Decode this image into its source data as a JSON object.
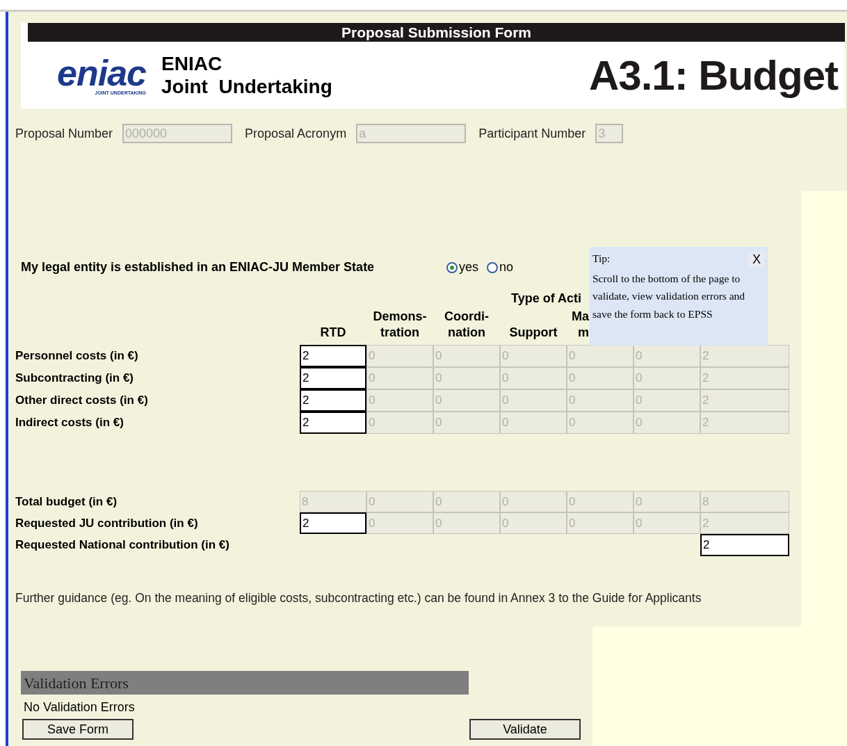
{
  "header": {
    "bar_title": "Proposal Submission Form",
    "logo_text": "eniac",
    "logo_subtitle": "JOINT UNDERTAKING",
    "org_line1": "ENIAC",
    "org_line2": "Joint  Undertaking",
    "page_title": "A3.1: Budget"
  },
  "fields": [
    {
      "label": "Proposal Number",
      "value": "000000"
    },
    {
      "label": "Proposal Acronym",
      "value": "a"
    },
    {
      "label": "Participant Number",
      "value": "3"
    }
  ],
  "legal_entity": {
    "question": "My legal entity is established in an ENIAC-JU Member State",
    "options": [
      {
        "label": "yes",
        "selected": true
      },
      {
        "label": "no",
        "selected": false
      }
    ]
  },
  "activity_heading": "Type of Acti",
  "columns": [
    {
      "lines": [
        "RTD"
      ]
    },
    {
      "lines": [
        "Demons-",
        "tration"
      ]
    },
    {
      "lines": [
        "Coordi-",
        "nation"
      ]
    },
    {
      "lines": [
        "Support"
      ]
    },
    {
      "lines": [
        "Ma",
        "m"
      ]
    }
  ],
  "cost_rows": [
    {
      "label": "Personnel costs (in €)",
      "cells": [
        {
          "value": "2",
          "editable": true
        },
        {
          "value": "0",
          "editable": false
        },
        {
          "value": "0",
          "editable": false
        },
        {
          "value": "0",
          "editable": false
        },
        {
          "value": "0",
          "editable": false
        },
        {
          "value": "0",
          "editable": false
        },
        {
          "value": "2",
          "editable": false
        }
      ]
    },
    {
      "label": "Subcontracting (in €)",
      "cells": [
        {
          "value": "2",
          "editable": true
        },
        {
          "value": "0",
          "editable": false
        },
        {
          "value": "0",
          "editable": false
        },
        {
          "value": "0",
          "editable": false
        },
        {
          "value": "0",
          "editable": false
        },
        {
          "value": "0",
          "editable": false
        },
        {
          "value": "2",
          "editable": false
        }
      ]
    },
    {
      "label": "Other direct costs (in €)",
      "cells": [
        {
          "value": "2",
          "editable": true
        },
        {
          "value": "0",
          "editable": false
        },
        {
          "value": "0",
          "editable": false
        },
        {
          "value": "0",
          "editable": false
        },
        {
          "value": "0",
          "editable": false
        },
        {
          "value": "0",
          "editable": false
        },
        {
          "value": "2",
          "editable": false
        }
      ]
    },
    {
      "label": "Indirect costs (in €)",
      "cells": [
        {
          "value": "2",
          "editable": true
        },
        {
          "value": "0",
          "editable": false
        },
        {
          "value": "0",
          "editable": false
        },
        {
          "value": "0",
          "editable": false
        },
        {
          "value": "0",
          "editable": false
        },
        {
          "value": "0",
          "editable": false
        },
        {
          "value": "2",
          "editable": false
        }
      ]
    }
  ],
  "total_rows": [
    {
      "label": "Total budget (in €)",
      "cells": [
        {
          "value": "8",
          "editable": false
        },
        {
          "value": "0",
          "editable": false
        },
        {
          "value": "0",
          "editable": false
        },
        {
          "value": "0",
          "editable": false
        },
        {
          "value": "0",
          "editable": false
        },
        {
          "value": "0",
          "editable": false
        },
        {
          "value": "8",
          "editable": false
        }
      ]
    },
    {
      "label": "Requested JU contribution (in €)",
      "cells": [
        {
          "value": "2",
          "editable": true
        },
        {
          "value": "0",
          "editable": false
        },
        {
          "value": "0",
          "editable": false
        },
        {
          "value": "0",
          "editable": false
        },
        {
          "value": "0",
          "editable": false
        },
        {
          "value": "0",
          "editable": false
        },
        {
          "value": "2",
          "editable": false
        }
      ]
    },
    {
      "label": "Requested National contribution (in €)",
      "cells": [
        {
          "kind": "empty"
        },
        {
          "kind": "empty"
        },
        {
          "kind": "empty"
        },
        {
          "kind": "empty"
        },
        {
          "kind": "empty"
        },
        {
          "kind": "empty"
        },
        {
          "value": "2",
          "editable": true
        }
      ]
    }
  ],
  "tip": {
    "title": "Tip:",
    "close": "X",
    "text": "Scroll to the bottom of the page to validate, view validation errors and save the form back to EPSS"
  },
  "guidance": "Further guidance (eg. On the meaning of eligible costs, subcontracting etc.) can be found in Annex 3 to the Guide for Applicants",
  "validation": {
    "heading": "Validation Errors",
    "message": "No Validation Errors"
  },
  "buttons": [
    {
      "label": "Save Form",
      "kind": "left"
    },
    {
      "label": "Validate",
      "kind": "right"
    }
  ]
}
